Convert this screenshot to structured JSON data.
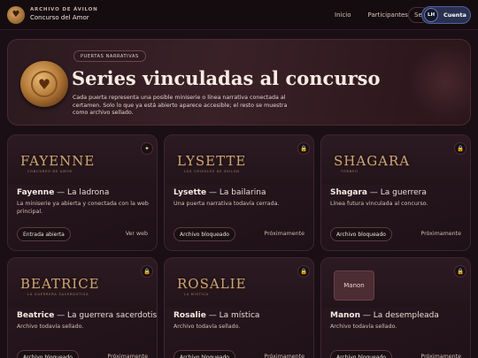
{
  "brand": {
    "kicker": "ARCHIVO DE ÁVILON",
    "title": "Concurso del Amor"
  },
  "nav": {
    "links": [
      "Inicio",
      "Participantes"
    ],
    "search_label": "Se",
    "account_initials": "LH",
    "account_label": "Cuenta"
  },
  "hero": {
    "pill": "PUERTAS NARRATIVAS",
    "title": "Series vinculadas al concurso",
    "description": "Cada puerta representa una posible miniserie o línea narrativa conectada al certamen. Solo lo que ya está abierto aparece accesible; el resto se muestra como archivo sellado."
  },
  "cards": [
    {
      "logo": "FAYENNE",
      "logo_sub": "CONCURSO DE AMOR",
      "badge_icon": "sparkle-icon",
      "badge_glyph": "✦",
      "name": "Fayenne",
      "sep": " — ",
      "role": "La ladrona",
      "desc": "La miniserie ya abierta y conectada con la web principal.",
      "button": "Entrada abierta",
      "link": "Ver web"
    },
    {
      "logo": "LYSETTE",
      "logo_sub": "LOS CRISOLES DE ÁVILON",
      "badge_icon": "lock-icon",
      "badge_glyph": "🔒",
      "name": "Lysette",
      "sep": " — ",
      "role": "La bailarina",
      "desc": "Una puerta narrativa todavía cerrada.",
      "button": "Archivo bloqueado",
      "link": "Próximamente"
    },
    {
      "logo": "SHAGARA",
      "logo_sub": "TORNEO",
      "badge_icon": "lock-icon",
      "badge_glyph": "🔒",
      "name": "Shagara",
      "sep": " — ",
      "role": "La guerrera",
      "desc": "Línea futura vinculada al concurso.",
      "button": "Archivo bloqueado",
      "link": "Próximamente"
    },
    {
      "logo": "BEATRICE",
      "logo_sub": "LA GUERRERA SACERDOTISA",
      "badge_icon": "lock-icon",
      "badge_glyph": "🔒",
      "name": "Beatrice",
      "sep": " — ",
      "role": "La guerrera sacerdotisa",
      "desc": "Archivo todavía sellado.",
      "button": "Archivo bloqueado",
      "link": "Próximamente"
    },
    {
      "logo": "ROSALIE",
      "logo_sub": "LA MÍSTICA",
      "badge_icon": "lock-icon",
      "badge_glyph": "🔒",
      "name": "Rosalie",
      "sep": " — ",
      "role": "La mística",
      "desc": "Archivo todavía sellado.",
      "button": "Archivo bloqueado",
      "link": "Próximamente"
    },
    {
      "logo": "Manon",
      "logo_sub": "",
      "badge_icon": "lock-icon",
      "badge_glyph": "🔒",
      "name": "Manon",
      "sep": " — ",
      "role": "La desempleada",
      "desc": "Archivo todavía sellado.",
      "button": "Archivo bloqueado",
      "link": "Próximamente"
    }
  ]
}
